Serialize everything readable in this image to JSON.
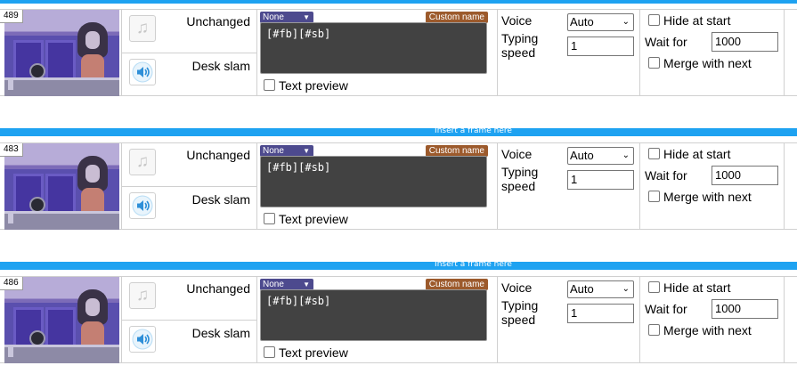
{
  "insert_label": "Insert a frame here",
  "common": {
    "music_label": "Unchanged",
    "sfx_label": "Desk slam",
    "pose_select": "None",
    "custom_name_label": "Custom name",
    "text_preview_label": "Text preview",
    "voice_label": "Voice",
    "voice_value": "Auto",
    "typing_speed_label": "Typing speed",
    "hide_at_start_label": "Hide at start",
    "wait_for_label": "Wait for",
    "merge_with_next_label": "Merge with next"
  },
  "frames": [
    {
      "id": "489",
      "text": "[#fb][#sb]",
      "typing_speed": "1",
      "wait_for": "1000"
    },
    {
      "id": "483",
      "text": "[#fb][#sb]",
      "typing_speed": "1",
      "wait_for": "1000"
    },
    {
      "id": "486",
      "text": "[#fb][#sb]",
      "typing_speed": "1",
      "wait_for": "1000"
    }
  ],
  "icons": {
    "music": "music-note-icon",
    "sound": "speaker-icon"
  },
  "colors": {
    "insert_bar": "#1ea2f1",
    "pose_select": "#4d4a8e",
    "custom_name": "#9c5a2c",
    "textarea_bg": "#424242"
  }
}
